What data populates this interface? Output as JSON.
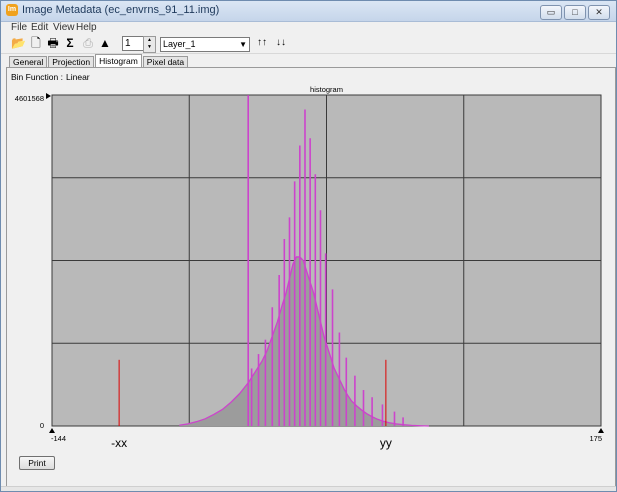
{
  "window": {
    "title": "Image Metadata (ec_envrns_91_11.img)",
    "icon_text": "Im",
    "minimize_glyph": "▭",
    "maximize_glyph": "□",
    "close_glyph": "✕"
  },
  "menu": [
    "File",
    "Edit",
    "View",
    "Help"
  ],
  "toolbar": {
    "layer_number": "1",
    "layer_select": "Layer_1",
    "spin_up": "▲",
    "spin_down": "▼",
    "select_caret": "▼",
    "icons": {
      "open": "📂",
      "new": "🗋",
      "print": "🖶",
      "sigma": "Σ",
      "disabled": "⎙",
      "histogram": "▲",
      "sort_up": "↑↑",
      "sort_down": "↓↓"
    }
  },
  "tabs": [
    {
      "label": "General",
      "active": false
    },
    {
      "label": "Projection",
      "active": false
    },
    {
      "label": "Histogram",
      "active": true
    },
    {
      "label": "Pixel data",
      "active": false
    }
  ],
  "bin_function": {
    "label": "Bin Function :",
    "value": "Linear"
  },
  "print_button": "Print",
  "colors": {
    "plot_bg": "#b9b9b9",
    "fill": "#9c9c9c",
    "line": "#cc44cc",
    "marker": "#dd0000",
    "grid": "#3a3a3a"
  },
  "chart_data": {
    "type": "area",
    "title": "histogram",
    "xlim": [
      -144,
      175
    ],
    "ylim": [
      0,
      4601568
    ],
    "x_min_label": "-144",
    "x_max_label": "175",
    "y_max_label": "4601568",
    "y_min_label": "0",
    "grid": true,
    "markers": [
      {
        "label": "-xx",
        "x": -105
      },
      {
        "label": "yy",
        "x": 50
      }
    ],
    "x": [
      -70,
      -65,
      -60,
      -55,
      -50,
      -45,
      -40,
      -35,
      -30,
      -26,
      -22,
      -19,
      -16,
      -13,
      -10,
      -8,
      -6,
      -4,
      -2,
      0,
      2,
      4,
      6,
      8,
      10,
      12,
      14,
      16,
      18,
      20,
      22,
      24,
      26,
      28,
      30,
      33,
      36,
      39,
      42,
      45,
      48,
      52,
      56,
      60,
      65,
      70,
      75
    ],
    "values": [
      10000,
      30000,
      60000,
      100000,
      160000,
      230000,
      330000,
      450000,
      600000,
      750000,
      900000,
      1050000,
      1250000,
      1450000,
      1700000,
      1850000,
      2050000,
      2250000,
      2350000,
      2350000,
      2300000,
      2150000,
      2000000,
      1850000,
      1650000,
      1450000,
      1250000,
      1100000,
      950000,
      800000,
      700000,
      600000,
      500000,
      420000,
      350000,
      280000,
      220000,
      170000,
      130000,
      95000,
      70000,
      45000,
      30000,
      18000,
      9000,
      4000,
      0
    ],
    "spikes": [
      {
        "x": -30,
        "y": 4600000
      },
      {
        "x": -28,
        "y": 800000
      },
      {
        "x": -24,
        "y": 1000000
      },
      {
        "x": -20,
        "y": 1200000
      },
      {
        "x": -16,
        "y": 1650000
      },
      {
        "x": -12,
        "y": 2100000
      },
      {
        "x": -9,
        "y": 2600000
      },
      {
        "x": -6,
        "y": 2900000
      },
      {
        "x": -3,
        "y": 3400000
      },
      {
        "x": 0,
        "y": 3900000
      },
      {
        "x": 3,
        "y": 4400000
      },
      {
        "x": 6,
        "y": 4000000
      },
      {
        "x": 9,
        "y": 3500000
      },
      {
        "x": 12,
        "y": 3000000
      },
      {
        "x": 15,
        "y": 2400000
      },
      {
        "x": 19,
        "y": 1900000
      },
      {
        "x": 23,
        "y": 1300000
      },
      {
        "x": 27,
        "y": 950000
      },
      {
        "x": 32,
        "y": 700000
      },
      {
        "x": 37,
        "y": 500000
      },
      {
        "x": 42,
        "y": 400000
      },
      {
        "x": 48,
        "y": 300000
      },
      {
        "x": 55,
        "y": 200000
      },
      {
        "x": 60,
        "y": 120000
      }
    ]
  }
}
